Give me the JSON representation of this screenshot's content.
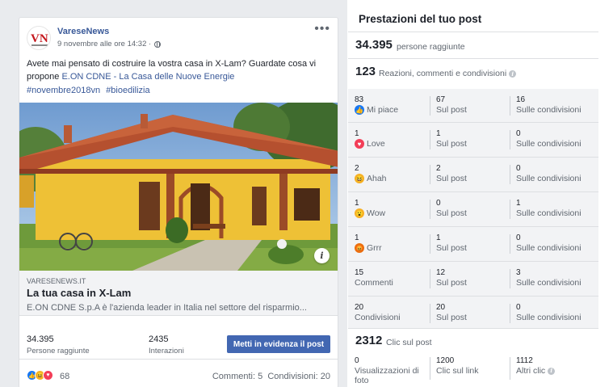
{
  "post": {
    "page_name": "VareseNews",
    "logo_text": "VN",
    "timestamp": "9 novembre alle ore 14:32 ·",
    "more_label": "•••",
    "text_before": "Avete mai pensato di costruire la vostra casa in X-Lam? Guardate cosa vi propone ",
    "text_link": "E.ON CDNE - La Casa delle Nuove Energie",
    "hashtags": [
      "#novembre2018vn",
      "#bioedilizia"
    ],
    "image_info_label": "i",
    "link": {
      "domain": "VARESENEWS.IT",
      "title": "La tua casa in X-Lam",
      "description": "E.ON CDNE S.p.A è l'azienda leader in Italia nel settore del risparmio..."
    },
    "stats": {
      "reach_value": "34.395",
      "reach_label": "Persone raggiunte",
      "interactions_value": "2435",
      "interactions_label": "Interazioni",
      "boost_label": "Metti in evidenza il post"
    },
    "reactions": {
      "count": "68",
      "comments": "Commenti: 5",
      "shares": "Condivisioni: 20",
      "icons": [
        "like-icon",
        "haha-icon",
        "love-icon"
      ]
    }
  },
  "insights": {
    "title": "Prestazioni del tuo post",
    "reach": {
      "value": "34.395",
      "label": "persone raggiunte"
    },
    "engagement": {
      "value": "123",
      "label": "Reazioni, commenti e condivisioni"
    },
    "rows": [
      {
        "icon": "like-icon",
        "total": "83",
        "label": "Mi piace",
        "on_post": "67",
        "on_post_label": "Sul post",
        "on_shares": "16",
        "on_shares_label": "Sulle condivisioni"
      },
      {
        "icon": "love-icon",
        "total": "1",
        "label": "Love",
        "on_post": "1",
        "on_post_label": "Sul post",
        "on_shares": "0",
        "on_shares_label": "Sulle condivisioni"
      },
      {
        "icon": "haha-icon",
        "total": "2",
        "label": "Ahah",
        "on_post": "2",
        "on_post_label": "Sul post",
        "on_shares": "0",
        "on_shares_label": "Sulle condivisioni"
      },
      {
        "icon": "wow-icon",
        "total": "1",
        "label": "Wow",
        "on_post": "0",
        "on_post_label": "Sul post",
        "on_shares": "1",
        "on_shares_label": "Sulle condivisioni"
      },
      {
        "icon": "angry-icon",
        "total": "1",
        "label": "Grrr",
        "on_post": "1",
        "on_post_label": "Sul post",
        "on_shares": "0",
        "on_shares_label": "Sulle condivisioni"
      },
      {
        "icon": "",
        "total": "15",
        "label": "Commenti",
        "on_post": "12",
        "on_post_label": "Sul post",
        "on_shares": "3",
        "on_shares_label": "Sulle condivisioni"
      },
      {
        "icon": "",
        "total": "20",
        "label": "Condivisioni",
        "on_post": "20",
        "on_post_label": "Sul post",
        "on_shares": "0",
        "on_shares_label": "Sulle condivisioni"
      }
    ],
    "clicks": {
      "value": "2312",
      "label": "Clic sul post"
    },
    "click_breakdown": [
      {
        "value": "0",
        "label": "Visualizzazioni di foto"
      },
      {
        "value": "1200",
        "label": "Clic sul link"
      },
      {
        "value": "1112",
        "label": "Altri clic"
      }
    ]
  },
  "colors": {
    "link": "#385898",
    "accent_button": "#4267b2",
    "panel_bg": "#f2f3f5",
    "like": "#1877f2",
    "love": "#f33e58",
    "haha": "#f7b125",
    "angry": "#e9710f"
  }
}
